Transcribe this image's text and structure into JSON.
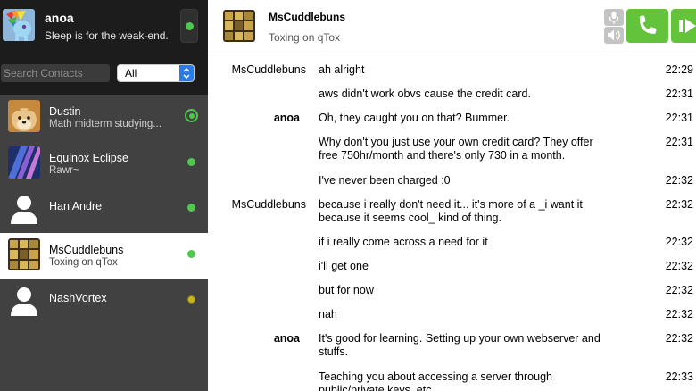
{
  "self": {
    "name": "anoa",
    "status_message": "Sleep is for the weak-end."
  },
  "search": {
    "placeholder": "Search Contacts"
  },
  "filter": {
    "selected": "All"
  },
  "contacts": [
    {
      "name": "Dustin",
      "status": "Math midterm studying..."
    },
    {
      "name": "Equinox Eclipse",
      "status": "Rawr~"
    },
    {
      "name": "Han Andre",
      "status": ""
    },
    {
      "name": "MsCuddlebuns",
      "status": "Toxing on qTox"
    },
    {
      "name": "NashVortex",
      "status": ""
    }
  ],
  "chat": {
    "name": "MsCuddlebuns",
    "status_message": "Toxing on qTox"
  },
  "colors": {
    "online": "#4ec84e",
    "away": "#c9b41c",
    "call_button": "#63c33a",
    "sidebar_bg": "#414141",
    "header_bg": "#1c1c1c"
  },
  "icons": {
    "mic": "microphone-icon",
    "volume": "speaker-icon",
    "call": "phone-icon",
    "video": "video-icon"
  },
  "messages": [
    {
      "author": "MsCuddlebuns",
      "text": "ah alright",
      "time": "22:29"
    },
    {
      "author": "",
      "text": "aws didn't work obvs cause the credit card.",
      "time": "22:31"
    },
    {
      "author": "anoa",
      "text": "Oh, they caught you on that? Bummer.",
      "time": "22:31"
    },
    {
      "author": "",
      "text": "Why don't you just use your own credit card? They offer free 750hr/month and there's only 730 in a month.",
      "time": "22:31"
    },
    {
      "author": "",
      "text": "I've never been charged :0",
      "time": "22:32"
    },
    {
      "author": "MsCuddlebuns",
      "text": "because i really don't need it... it's more of a _i want it because it seems cool_ kind of thing.",
      "time": "22:32"
    },
    {
      "author": "",
      "text": "if i really come across a need for it",
      "time": "22:32"
    },
    {
      "author": "",
      "text": "i'll get one",
      "time": "22:32"
    },
    {
      "author": "",
      "text": "but for now",
      "time": "22:32"
    },
    {
      "author": "",
      "text": "nah",
      "time": "22:32"
    },
    {
      "author": "anoa",
      "text": "It's good for learning. Setting up your own webserver and stuffs.",
      "time": "22:32"
    },
    {
      "author": "",
      "text": "Teaching you about accessing a server through public/private keys, etc.",
      "time": "22:33"
    }
  ]
}
